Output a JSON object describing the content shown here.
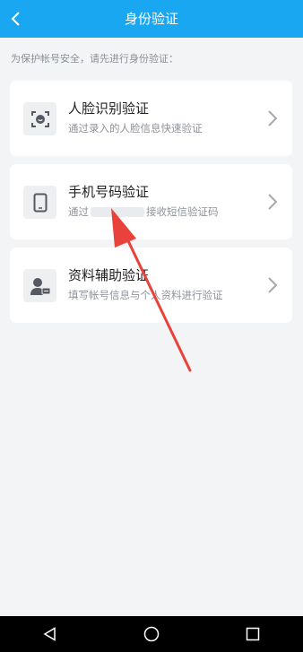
{
  "header": {
    "title": "身份验证",
    "back_icon": "chevron-left-icon"
  },
  "hint": "为保护帐号安全，请先进行身份验证：",
  "options": [
    {
      "title": "人脸识别验证",
      "subtitle": "通过录入的人脸信息快速验证",
      "icon": "face-scan-icon"
    },
    {
      "title": "手机号码验证",
      "subtitle_prefix": "通过",
      "subtitle_suffix": "接收短信验证码",
      "icon": "phone-icon"
    },
    {
      "title": "资料辅助验证",
      "subtitle": "填写帐号信息与个人资料进行验证",
      "icon": "id-card-icon"
    }
  ],
  "colors": {
    "header": "#1aa7f2",
    "annotation_arrow": "#e8423b"
  },
  "navbar": {
    "back": "triangle-back-icon",
    "home": "circle-home-icon",
    "recents": "square-recents-icon"
  }
}
